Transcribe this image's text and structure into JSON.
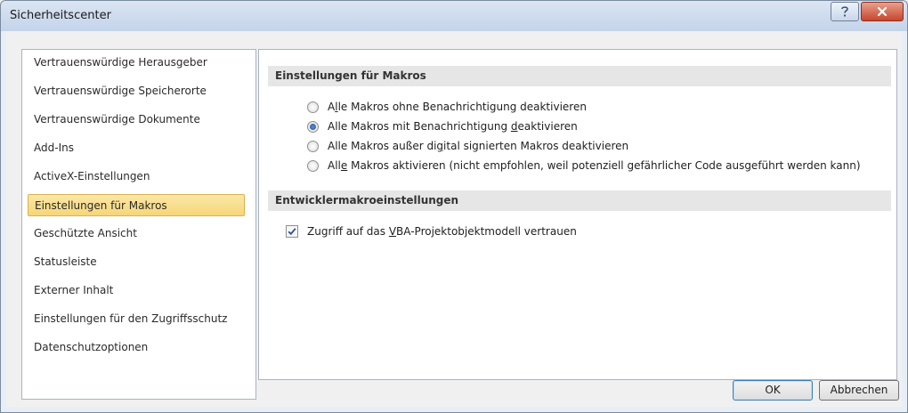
{
  "window": {
    "title": "Sicherheitscenter"
  },
  "sidebar": {
    "items": [
      {
        "label": "Vertrauenswürdige Herausgeber"
      },
      {
        "label": "Vertrauenswürdige Speicherorte"
      },
      {
        "label": "Vertrauenswürdige Dokumente"
      },
      {
        "label": "Add-Ins"
      },
      {
        "label": "ActiveX-Einstellungen"
      },
      {
        "label": "Einstellungen für Makros",
        "selected": true
      },
      {
        "label": "Geschützte Ansicht"
      },
      {
        "label": "Statusleiste"
      },
      {
        "label": "Externer Inhalt"
      },
      {
        "label": "Einstellungen für den Zugriffsschutz"
      },
      {
        "label": "Datenschutzoptionen"
      }
    ]
  },
  "macro_settings": {
    "header": "Einstellungen für Makros",
    "selected_index": 1,
    "options": [
      {
        "pre": "A",
        "ul": "l",
        "post": "le Makros ohne Benachrichtigung deaktivieren"
      },
      {
        "pre": "Alle Makros mit Benachrichtigung ",
        "ul": "d",
        "post": "eaktivieren"
      },
      {
        "pre": "Alle Makros außer di",
        "ul": "g",
        "post": "ital signierten Makros deaktivieren"
      },
      {
        "pre": "All",
        "ul": "e",
        "post": " Makros aktivieren (nicht empfohlen, weil potenziell gefährlicher Code ausgeführt werden kann)"
      }
    ]
  },
  "developer_settings": {
    "header": "Entwicklermakroeinstellungen",
    "vba_checkbox": {
      "pre": "Zugriff auf das ",
      "ul": "V",
      "post": "BA-Projektobjektmodell vertrauen",
      "checked": true
    }
  },
  "buttons": {
    "ok": "OK",
    "cancel": "Abbrechen"
  },
  "icons": {
    "help": "help-icon",
    "close": "close-icon",
    "check": "checkmark-icon"
  }
}
